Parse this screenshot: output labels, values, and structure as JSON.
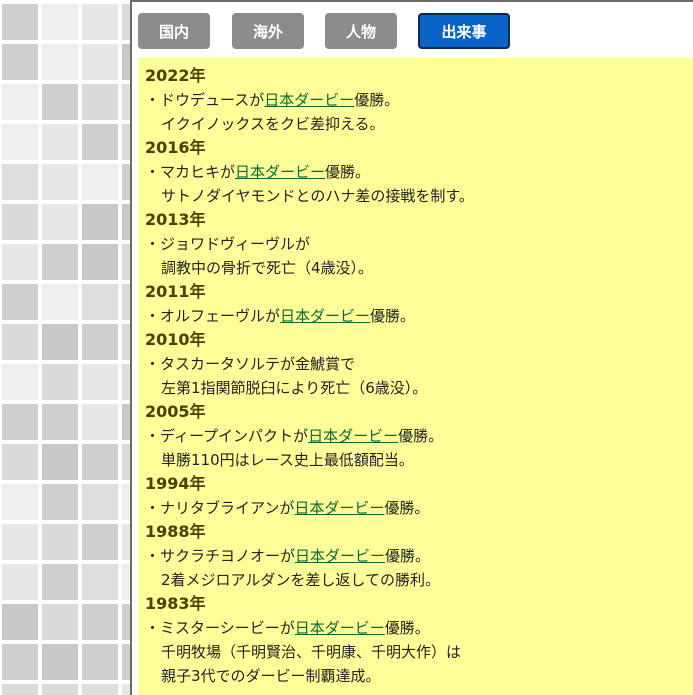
{
  "tabs": [
    {
      "label": "国内",
      "active": false
    },
    {
      "label": "海外",
      "active": false
    },
    {
      "label": "人物",
      "active": false
    },
    {
      "label": "出来事",
      "active": true
    }
  ],
  "events": [
    {
      "year": "2022年",
      "lines": [
        {
          "pre": "・ドウデュースが",
          "link": "日本ダービー",
          "post": "優勝。"
        },
        {
          "cont": "イクイノックスをクビ差抑える。"
        }
      ]
    },
    {
      "year": "2016年",
      "lines": [
        {
          "pre": "・マカヒキが",
          "link": "日本ダービー",
          "post": "優勝。"
        },
        {
          "cont": "サトノダイヤモンドとのハナ差の接戦を制す。"
        }
      ]
    },
    {
      "year": "2013年",
      "lines": [
        {
          "pre": "・ジョワドヴィーヴルが"
        },
        {
          "cont": "調教中の骨折で死亡（4歳没）。"
        }
      ]
    },
    {
      "year": "2011年",
      "lines": [
        {
          "pre": "・オルフェーヴルが",
          "link": "日本ダービー",
          "post": "優勝。"
        }
      ]
    },
    {
      "year": "2010年",
      "lines": [
        {
          "pre": "・タスカータソルテが金鯱賞で"
        },
        {
          "cont": "左第1指関節脱臼により死亡（6歳没）。"
        }
      ]
    },
    {
      "year": "2005年",
      "lines": [
        {
          "pre": "・ディープインパクトが",
          "link": "日本ダービー",
          "post": "優勝。"
        },
        {
          "cont": "単勝110円はレース史上最低額配当。"
        }
      ]
    },
    {
      "year": "1994年",
      "lines": [
        {
          "pre": "・ナリタブライアンが",
          "link": "日本ダービー",
          "post": "優勝。"
        }
      ]
    },
    {
      "year": "1988年",
      "lines": [
        {
          "pre": "・サクラチヨノオーが",
          "link": "日本ダービー",
          "post": "優勝。"
        },
        {
          "cont": "2着メジロアルダンを差し返しての勝利。"
        }
      ]
    },
    {
      "year": "1983年",
      "lines": [
        {
          "pre": "・ミスターシービーが",
          "link": "日本ダービー",
          "post": "優勝。"
        },
        {
          "cont": "千明牧場（千明賢治、千明康、千明大作）は"
        },
        {
          "cont": "親子3代でのダービー制覇達成。"
        }
      ]
    }
  ]
}
